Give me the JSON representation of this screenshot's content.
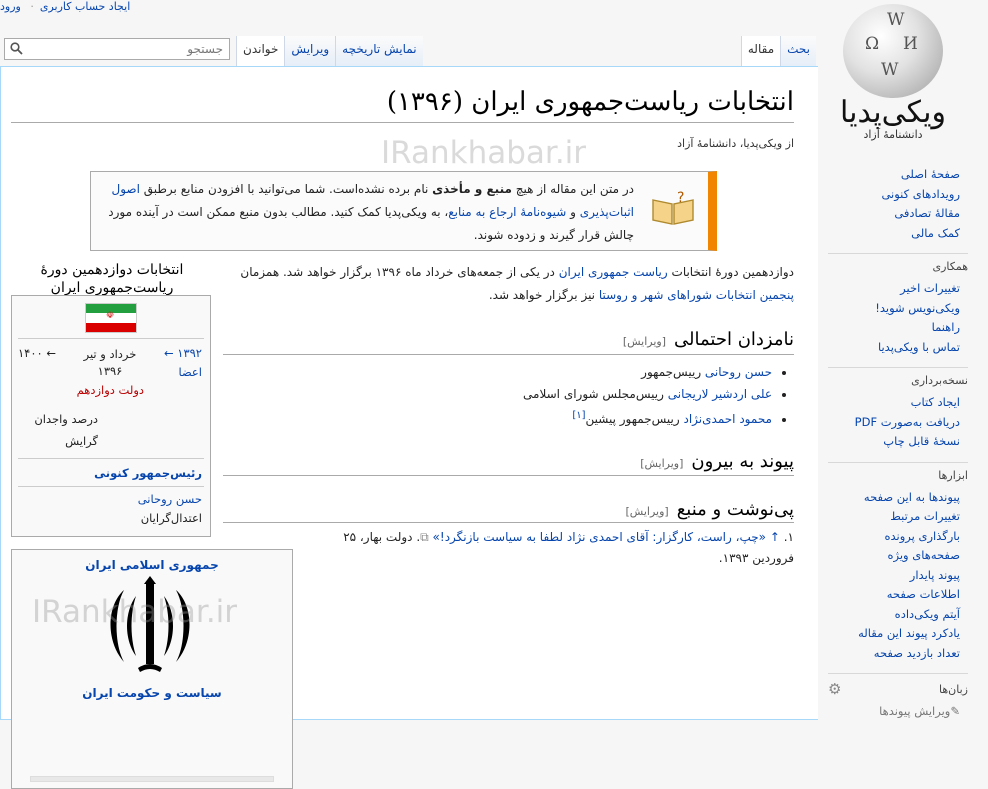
{
  "personal": {
    "create_account": "ایجاد حساب کاربری",
    "login": "ورود"
  },
  "logo": {
    "wordmark": "ویکی‌پدیا",
    "tagline": "دانشنامهٔ آزاد"
  },
  "tabs": {
    "article": "مقاله",
    "talk": "بحث",
    "read": "خواندن",
    "edit": "ویرایش",
    "history": "نمایش تاریخچه"
  },
  "search": {
    "placeholder": "جستجو"
  },
  "sidebar": {
    "nav": [
      "صفحهٔ اصلی",
      "رویدادهای کنونی",
      "مقالهٔ تصادفی",
      "کمک مالی"
    ],
    "interaction": {
      "heading": "همکاری",
      "items": [
        "تغییرات اخیر",
        "ویکی‌نویس شوید!",
        "راهنما",
        "تماس با ویکی‌پدیا"
      ]
    },
    "print": {
      "heading": "نسخه‌برداری",
      "items": [
        "ایجاد کتاب",
        "دریافت به‌صورت PDF",
        "نسخهٔ قابل چاپ"
      ]
    },
    "tools": {
      "heading": "ابزارها",
      "items": [
        "پیوندها به این صفحه",
        "تغییرات مرتبط",
        "بارگذاری پرونده",
        "صفحه‌های ویژه",
        "پیوند پایدار",
        "اطلاعات صفحه",
        "آیتم ویکی‌داده",
        "یادکرد پیوند این مقاله",
        "تعداد بازدید صفحه"
      ]
    },
    "languages": {
      "heading": "زبان‌ها",
      "edit_links": "ویرایش پیوندها"
    }
  },
  "article": {
    "title": "انتخابات ریاست‌جمهوری ایران (۱۳۹۶)",
    "site_sub": "از ویکی‌پدیا، دانشنامهٔ آزاد",
    "watermark": "IRankhabar.ir",
    "ambox": {
      "p1": "در متن این مقاله از هیچ ",
      "b1": "منبع و مأخذی",
      "p2": " نام برده نشده‌است. شما می‌توانید با افزودن منابع برطبق ",
      "l1": "اصول اثبات‌پذیری",
      "p3": " و ",
      "l2": "شیوه‌نامهٔ ارجاع به منابع",
      "p4": "، به ویکی‌پدیا کمک کنید. مطالب بدون منبع ممکن است در آینده مورد چالش قرار گیرند و زدوده شوند."
    },
    "lede": {
      "p1": "دوازدهمین دورهٔ انتخابات ",
      "l1": "ریاست جمهوری ایران",
      "p2": " در یکی از جمعه‌های خرداد ماه ۱۳۹۶ برگزار خواهد شد. همزمان ",
      "l2": "پنجمین انتخابات شوراهای شهر و روستا",
      "p3": " نیز برگزار خواهد شد."
    },
    "edit_label": "[ویرایش]",
    "sections": {
      "candidates": "نامزدان احتمالی",
      "external": "پیوند به بیرون",
      "references": "پی‌نوشت و منبع"
    },
    "candidates": [
      {
        "name": "حسن روحانی",
        "role": " رییس‌جمهور",
        "note": ""
      },
      {
        "name": "علی اردشیر لاریجانی",
        "role": " رییس‌مجلس شورای اسلامی",
        "note": ""
      },
      {
        "name": "محمود احمدی‌نژاد",
        "role": " رییس‌جمهور پیشین",
        "note": "[۱]"
      }
    ],
    "reference": {
      "num": "۱.",
      "arrow": "↑",
      "link": "«چپ، راست، کارگزار: آقای احمدی نژاد لطفا به سیاست بازنگرد!»",
      "rest": ". دولت بهار، ۲۵ فروردین ۱۳۹۳."
    }
  },
  "infobox": {
    "title": "انتخابات دوازدهمین دورهٔ ریاست‌جمهوری ایران",
    "prev_year": "۱۳۹۲ ←",
    "current": "خرداد و تیر ۱۳۹۶",
    "next_year": "← ۱۴۰۰",
    "members": "اعضا",
    "government": "دولت دوازدهم",
    "turnout": "درصد واجدان",
    "tendency": "گرایش",
    "incumbent_heading": "رئیس‌جمهور کنونی",
    "incumbent_name": "حسن روحانی",
    "incumbent_party": "اعتدال‌گرایان"
  },
  "govbox": {
    "title": "جمهوری اسلامی ایران",
    "footer": "سیاست و حکومت ایران"
  }
}
